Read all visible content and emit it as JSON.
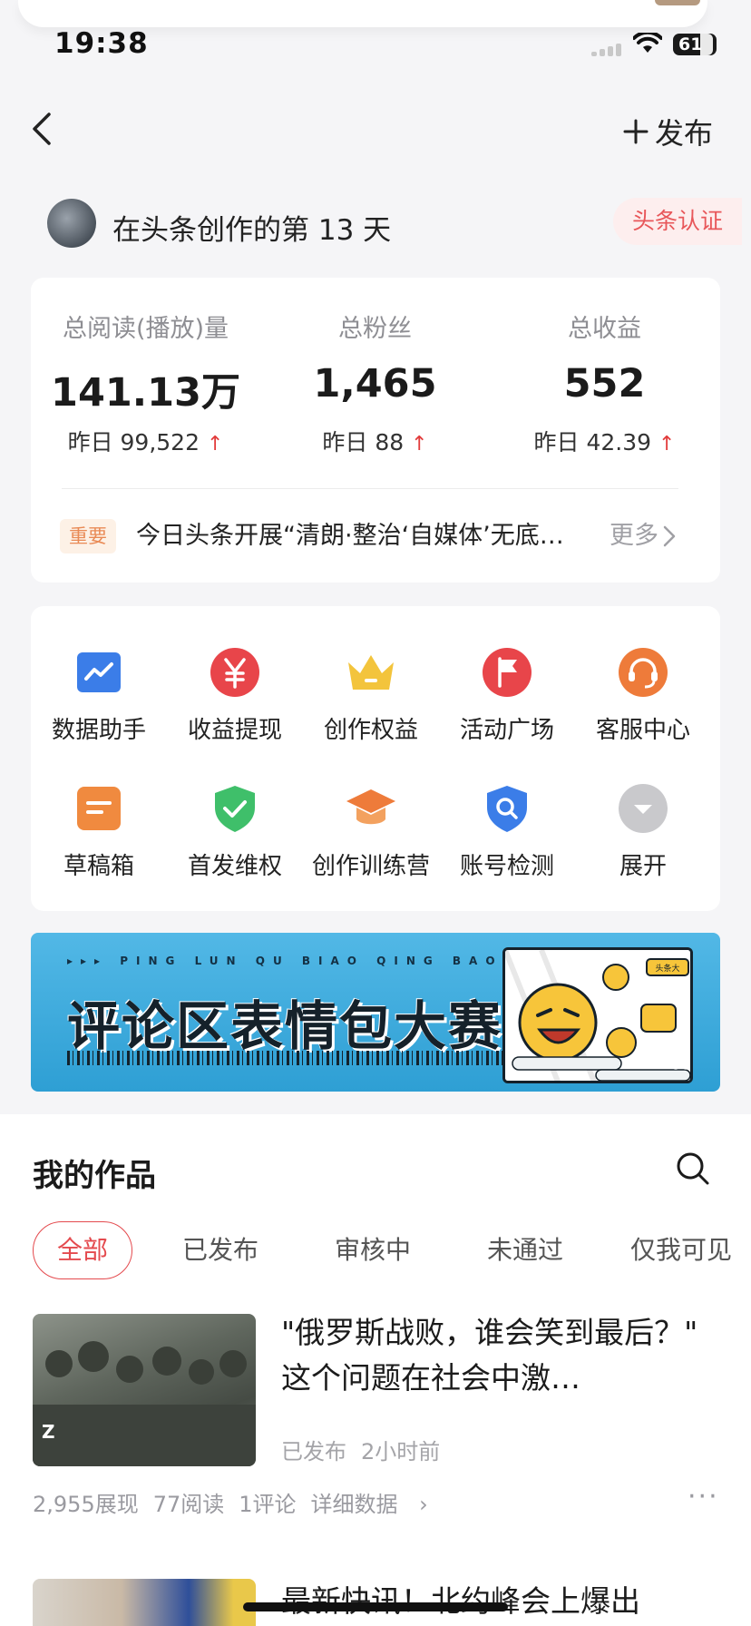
{
  "status_bar": {
    "time": "19:38",
    "battery": "61"
  },
  "nav": {
    "publish_label": "发布"
  },
  "creator": {
    "text": "在头条创作的第 13 天",
    "verify_label": "头条认证"
  },
  "stats": [
    {
      "label": "总阅读(播放)量",
      "value": "141.13万",
      "sub": "昨日 99,522"
    },
    {
      "label": "总粉丝",
      "value": "1,465",
      "sub": "昨日 88"
    },
    {
      "label": "总收益",
      "value": "552",
      "sub": "昨日 42.39"
    }
  ],
  "notice": {
    "badge": "重要",
    "text": "今日头条开展“清朗·整治‘自媒体’无底…",
    "more": "更多"
  },
  "tools": [
    {
      "label": "数据助手",
      "icon": "chart-icon",
      "color": "#3b7de8"
    },
    {
      "label": "收益提现",
      "icon": "yuan-icon",
      "color": "#e8454a"
    },
    {
      "label": "创作权益",
      "icon": "crown-icon",
      "color": "#f3c43c"
    },
    {
      "label": "活动广场",
      "icon": "flag-icon",
      "color": "#e8454a"
    },
    {
      "label": "客服中心",
      "icon": "headset-icon",
      "color": "#ee7b3a"
    },
    {
      "label": "草稿箱",
      "icon": "draft-icon",
      "color": "#f08a3f"
    },
    {
      "label": "首发维权",
      "icon": "shield-check-icon",
      "color": "#3fbf6a"
    },
    {
      "label": "创作训练营",
      "icon": "graduation-cap-icon",
      "color": "#ee7b3a"
    },
    {
      "label": "账号检测",
      "icon": "shield-search-icon",
      "color": "#3b7de8"
    },
    {
      "label": "展开",
      "icon": "expand-icon",
      "color": "#c9c9cc"
    }
  ],
  "banner": {
    "subtitle": "▸▸▸ PING LUN QU BIAO QING BAO DA SAI",
    "title": "评论区表情包大赛",
    "tag": "头条大"
  },
  "works": {
    "title": "我的作品",
    "tabs": [
      "全部",
      "已发布",
      "审核中",
      "未通过",
      "仅我可见"
    ],
    "articles": [
      {
        "title": "\"俄罗斯战败，谁会笑到最后？\" 这个问题在社会中激…",
        "status": "已发布",
        "time": "2小时前",
        "impressions": "2,955展现",
        "reads": "77阅读",
        "comments": "1评论",
        "detail": "详细数据"
      },
      {
        "title": "最新快讯！北约峰会上爆出"
      }
    ]
  }
}
